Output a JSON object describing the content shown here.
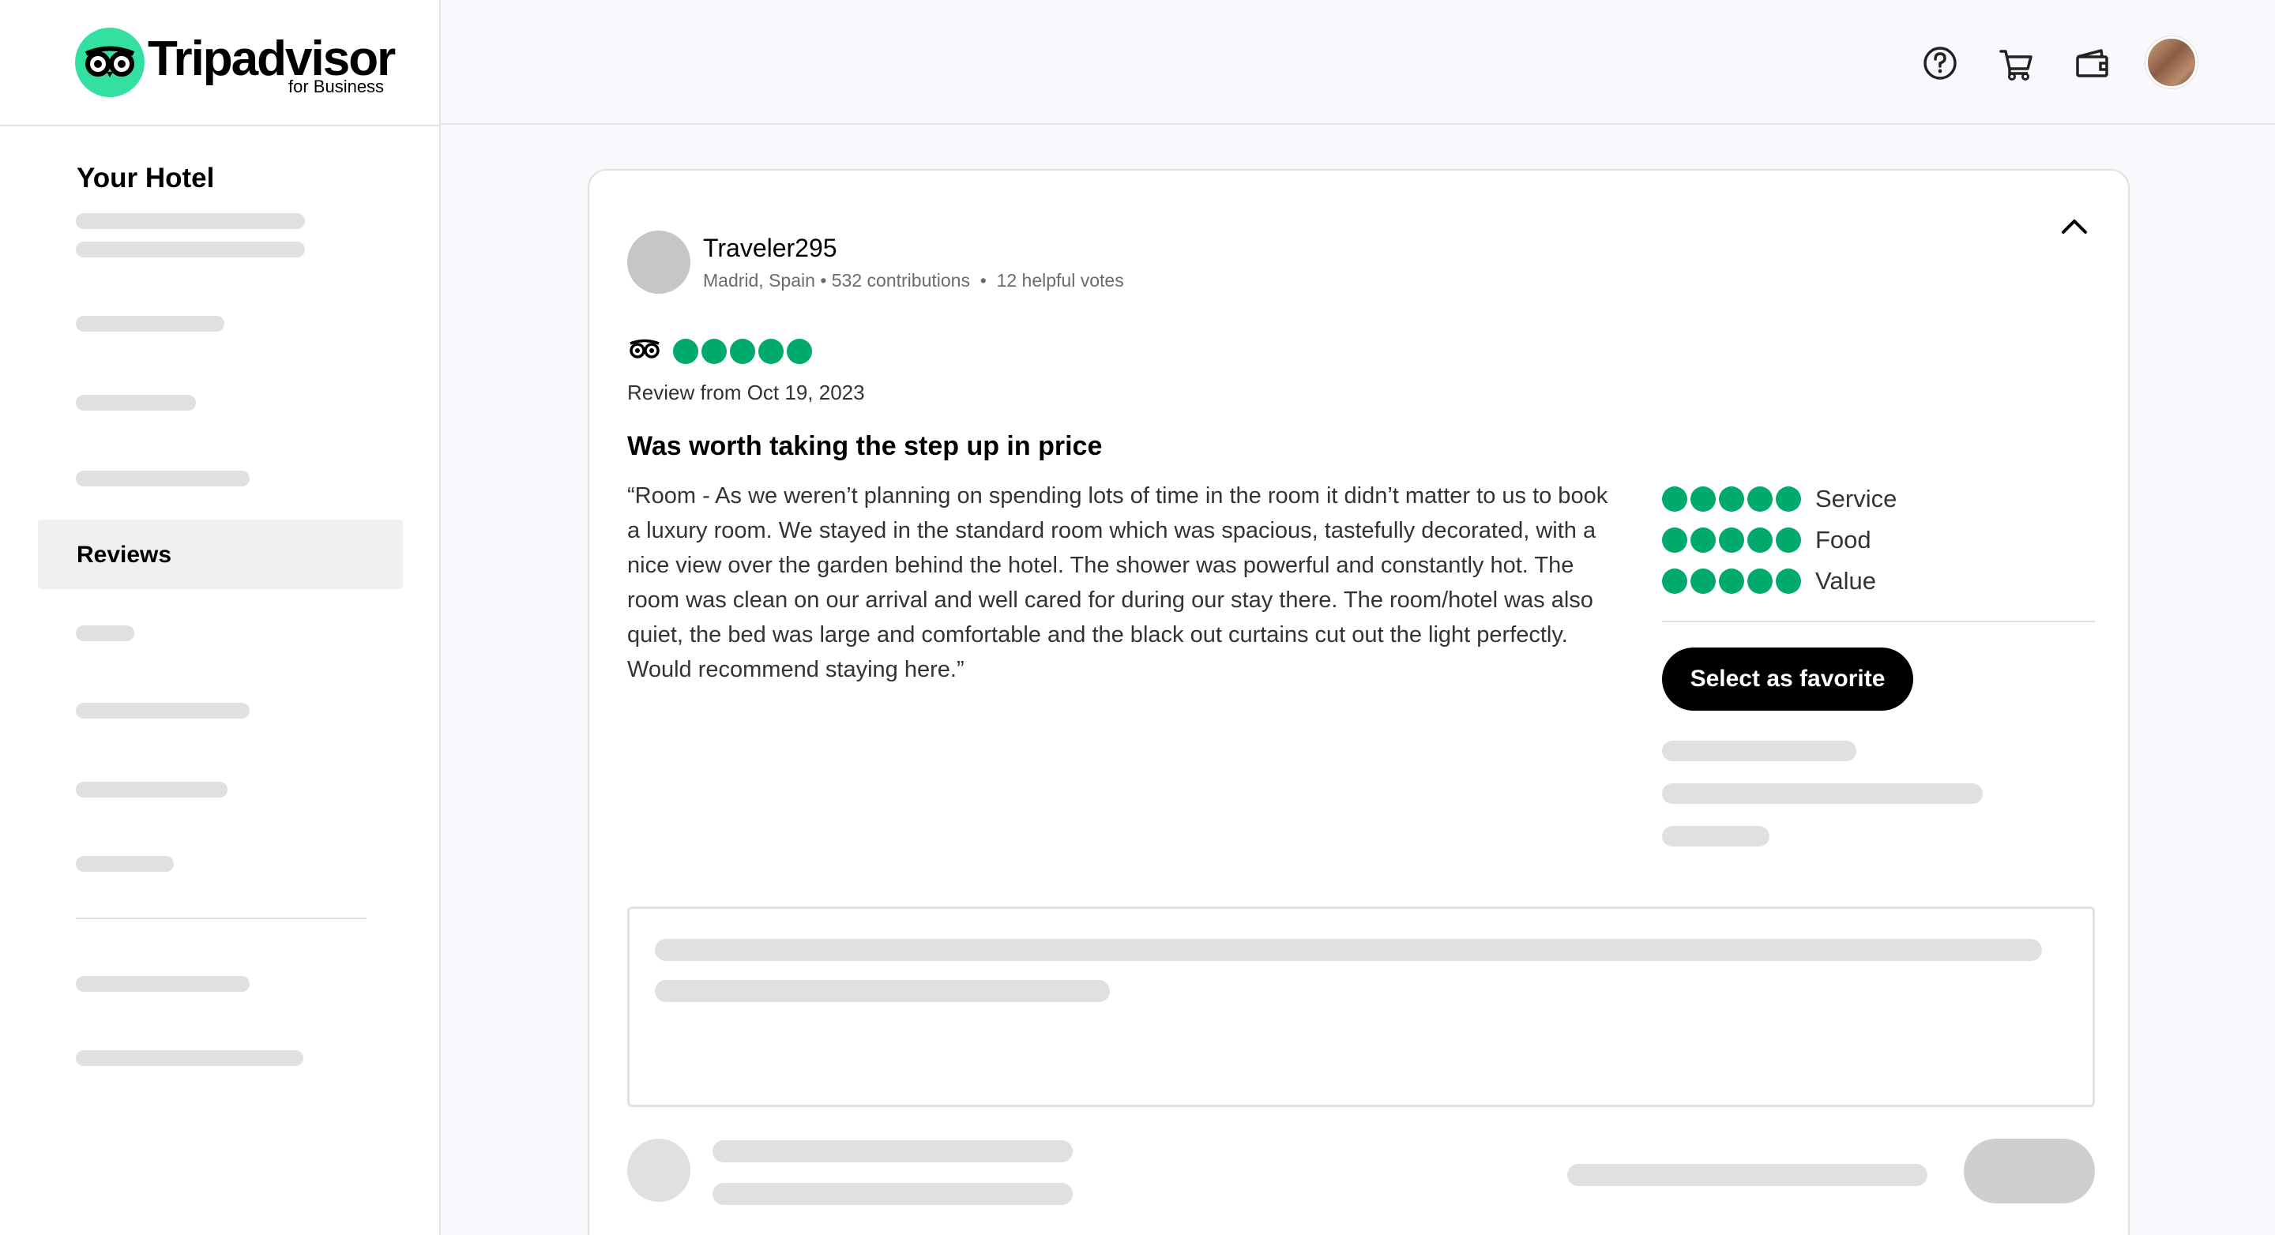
{
  "brand": {
    "name": "Tripadvisor",
    "sub": "for Business",
    "color": "#34e0a1"
  },
  "sidebar": {
    "title": "Your Hotel",
    "active_item": "Reviews"
  },
  "header": {
    "icons": [
      "help-icon",
      "cart-icon",
      "wallet-icon",
      "user-avatar"
    ]
  },
  "review": {
    "reviewer": {
      "name": "Traveler295",
      "location": "Madrid, Spain",
      "contributions": "532 contributions",
      "helpful_votes": "12 helpful votes"
    },
    "rating": 5,
    "date": "Review from Oct 19, 2023",
    "title": "Was worth taking the step up in price",
    "body": "“Room - As we weren’t planning on spending lots of time in the room it didn’t matter to us to book a luxury room. We stayed in the standard room which was spacious, tastefully decorated, with a nice view over the garden behind the hotel. The shower was powerful and constantly hot. The room was clean on our arrival and well cared for during our stay there. The room/hotel was also quiet, the bed was large and comfortable and the black out curtains cut out the light perfectly. Would recommend staying here.”",
    "subratings": [
      {
        "label": "Service",
        "value": 5
      },
      {
        "label": "Food",
        "value": 5
      },
      {
        "label": "Value",
        "value": 5
      }
    ],
    "favorite_button": "Select as favorite"
  },
  "colors": {
    "bubble": "#00aa6c",
    "placeholder": "#e0e0e0"
  }
}
